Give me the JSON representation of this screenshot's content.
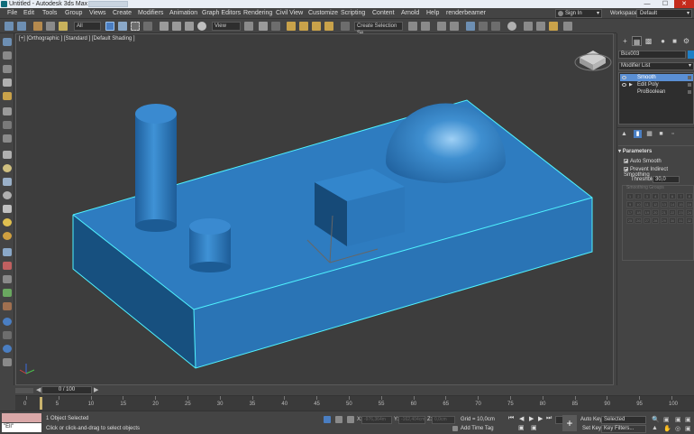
{
  "window": {
    "title": "Untitled - Autodesk 3ds Max 2018",
    "controls": [
      "—",
      "☐",
      "✕"
    ]
  },
  "menu": [
    "File",
    "Edit",
    "Tools",
    "Group",
    "Views",
    "Create",
    "Modifiers",
    "Animation",
    "Graph Editors",
    "Rendering",
    "Civil View",
    "Customize",
    "Scripting",
    "Content",
    "Arnold",
    "Help",
    "renderbeamer"
  ],
  "account": {
    "sign_in": "Sign In",
    "workspaces_label": "Workspaces:",
    "workspace": "Default"
  },
  "toolbar": {
    "filter": "All",
    "ref_coord": "View",
    "selection_set": "Create Selection Se",
    "layer": "0 (default)"
  },
  "viewport": {
    "label": "[+] [Orthographic ] [Standard ] [Default Shading ]",
    "object_color": "#2a78c0",
    "selection_outline": "#4ff3ff"
  },
  "command_panel": {
    "object_name": "Box003",
    "object_color": "#1f7fc6",
    "modifier_list": "Modifier List",
    "stack": [
      {
        "label": "Smooth",
        "selected": true,
        "expander": ""
      },
      {
        "label": "Edit Poly",
        "selected": false,
        "expander": "▶"
      },
      {
        "label": "ProBoolean",
        "selected": false,
        "expander": ""
      }
    ],
    "parameters": {
      "title": "Parameters",
      "auto_smooth": "Auto Smooth",
      "prevent_indirect": "Prevent Indirect Smoothing",
      "threshold_label": "Threshold:",
      "threshold_value": "30,0",
      "smoothing_groups_label": "Smoothing Groups",
      "groups": [
        "1",
        "2",
        "3",
        "4",
        "5",
        "6",
        "7",
        "8",
        "9",
        "10",
        "11",
        "12",
        "13",
        "14",
        "15",
        "16",
        "17",
        "18",
        "19",
        "20",
        "21",
        "22",
        "23",
        "24",
        "25",
        "26",
        "27",
        "28",
        "29",
        "30",
        "31",
        "32"
      ]
    }
  },
  "timeline": {
    "frame_field": "0 / 100",
    "ticks": [
      "0",
      "5",
      "10",
      "15",
      "20",
      "25",
      "30",
      "35",
      "40",
      "45",
      "50",
      "55",
      "60",
      "65",
      "70",
      "75",
      "80",
      "85",
      "90",
      "95",
      "100"
    ]
  },
  "status": {
    "maxscript": "\"Ell\"",
    "selected": "1 Object Selected",
    "prompt": "Click or click-and-drag to select objects",
    "x_label": "X:",
    "x_value": "-976,364m",
    "y_label": "Y:",
    "y_value": "-162,404cm",
    "z_label": "Z:",
    "z_value": "0,0cm",
    "grid": "Grid = 10,0cm",
    "add_time_tag": "Add Time Tag",
    "auto_key": "Auto Key",
    "set_key": "Set Key",
    "key_mode": "Selected",
    "key_filters": "Key Filters..."
  }
}
